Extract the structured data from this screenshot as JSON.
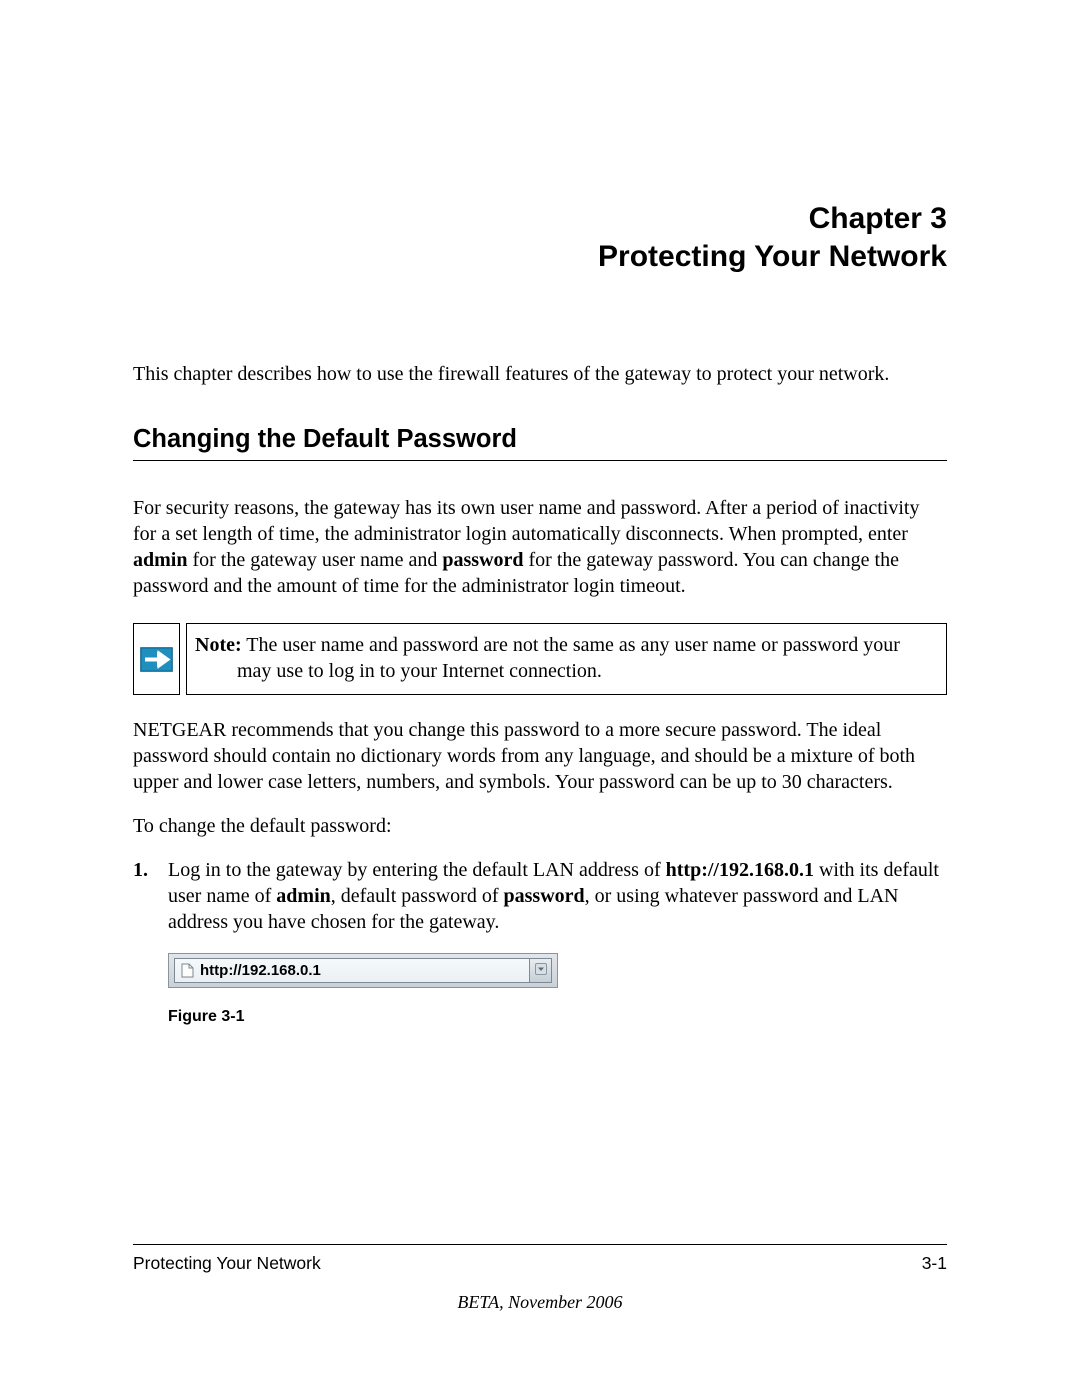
{
  "chapter": {
    "line1": "Chapter 3",
    "line2": "Protecting Your Network"
  },
  "intro": "This chapter describes how to use the firewall features of the gateway to protect your network.",
  "section_heading": "Changing the Default Password",
  "para1": {
    "seg1": "For security reasons, the gateway has its own user name and password. After a period of inactivity for a set length of time, the administrator login automatically disconnects. When prompted, enter ",
    "admin": "admin",
    "seg2": " for the gateway user name and ",
    "password": "password",
    "seg3": " for the gateway password. You can change the password and the amount of time for the administrator login timeout."
  },
  "note": {
    "label": "Note:",
    "line1": " The user name and password are not the same as any user name or password your",
    "line2": "may use to log in to your Internet connection."
  },
  "para2": "NETGEAR recommends that you change this password to a more secure password. The ideal password should contain no dictionary words from any language, and should be a mixture of both upper and lower case letters, numbers, and symbols. Your password can be up to 30 characters.",
  "para3": "To change the default password:",
  "step1": {
    "num": "1.",
    "seg1": "Log in to the gateway by entering the default LAN address of ",
    "url": "http://192.168.0.1",
    "seg2": " with its default user name of ",
    "admin": "admin",
    "seg3": ", default password of ",
    "password": "password",
    "seg4": ", or using whatever password and LAN address you have chosen for the gateway."
  },
  "addressbar": {
    "url": "http://192.168.0.1"
  },
  "figure_caption": "Figure 3-1",
  "footer": {
    "left": "Protecting Your Network",
    "right": "3-1",
    "center": "BETA, November 2006"
  }
}
